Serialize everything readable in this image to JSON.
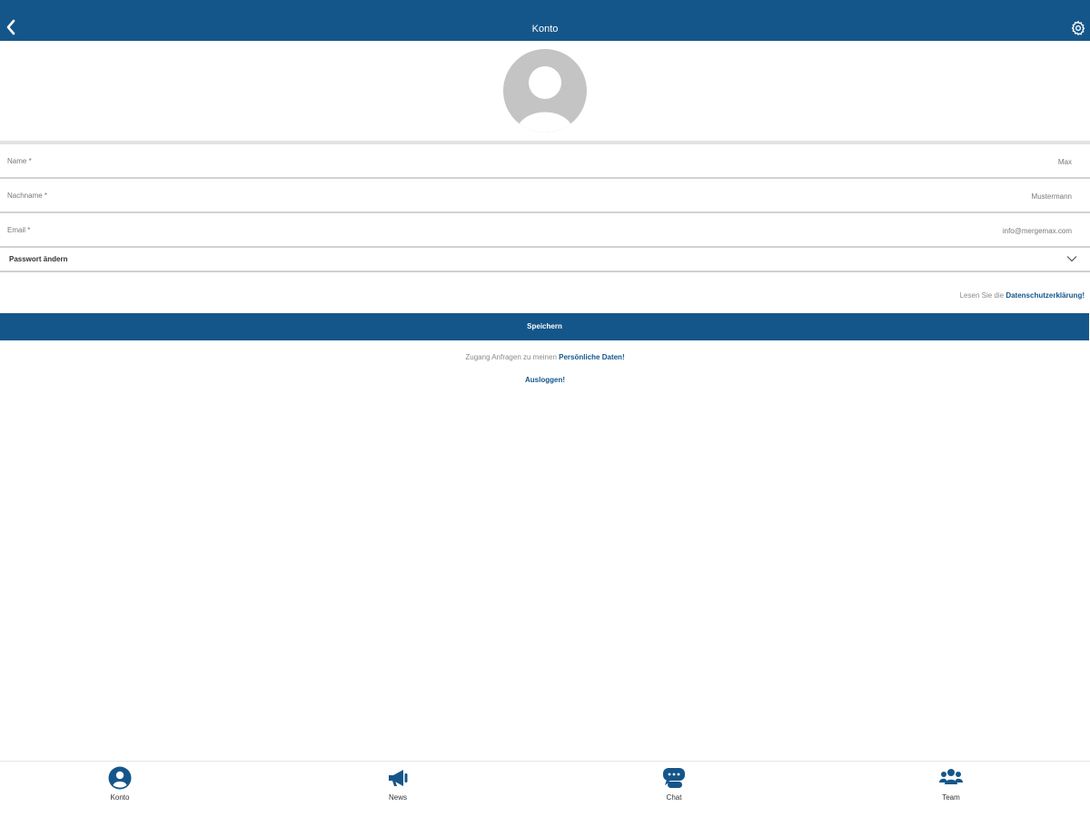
{
  "header": {
    "title": "Konto",
    "back_icon": "chevron-left-icon",
    "settings_icon": "gear-icon"
  },
  "colors": {
    "brand": "#15568a",
    "avatar_bg": "#c4c4c4",
    "divider": "#d2d2d2"
  },
  "profile": {
    "avatar_icon": "user-placeholder-icon"
  },
  "form": {
    "name_label": "Name *",
    "name_value": "Max",
    "surname_label": "Nachname *",
    "surname_value": "Mustermann",
    "email_label": "Email *",
    "email_value": "info@mergemax.com",
    "password_label": "Passwort ändern",
    "password_icon": "chevron-down-icon"
  },
  "privacy": {
    "prefix": "Lesen Sie die",
    "link": "Datenschutzerklärung!"
  },
  "actions": {
    "save_label": "Speichern",
    "access_prefix": "Zugang Anfragen zu meinen",
    "access_link": "Persönliche Daten!",
    "logout_label": "Ausloggen!"
  },
  "tabbar": {
    "items": [
      {
        "label": "Konto",
        "icon": "user-circle-icon"
      },
      {
        "label": "News",
        "icon": "megaphone-icon"
      },
      {
        "label": "Chat",
        "icon": "chat-bubbles-icon"
      },
      {
        "label": "Team",
        "icon": "users-group-icon"
      }
    ]
  }
}
